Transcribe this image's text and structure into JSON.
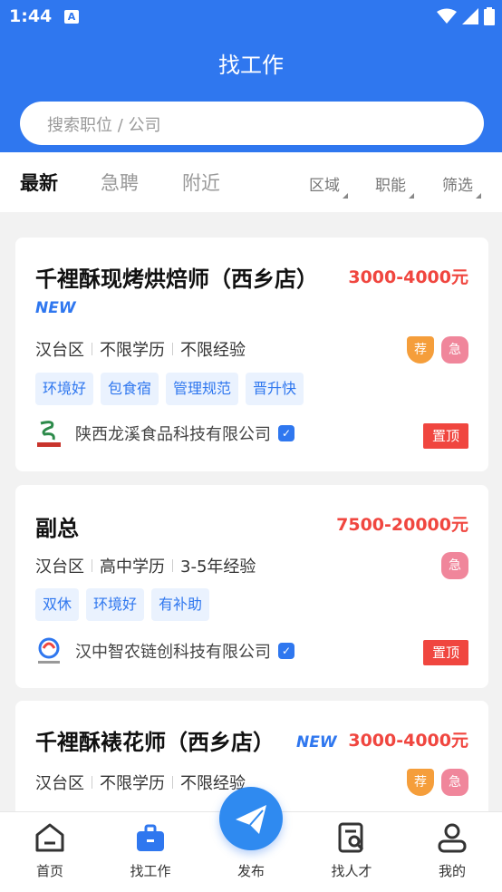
{
  "status": {
    "time": "1:44",
    "notif_icon": "A"
  },
  "header": {
    "title": "找工作"
  },
  "search": {
    "placeholder": "搜索职位 / 公司"
  },
  "tabs": [
    "最新",
    "急聘",
    "附近"
  ],
  "filters": [
    "区域",
    "职能",
    "筛选"
  ],
  "jobs": [
    {
      "title": "千裡酥现烤烘焙师（西乡店）",
      "salary": "3000-4000元",
      "new": "NEW",
      "location": "汉台区",
      "education": "不限学历",
      "experience": "不限经验",
      "tags": [
        "环境好",
        "包食宿",
        "管理规范",
        "晋升快"
      ],
      "company": "陕西龙溪食品科技有限公司",
      "badges": [
        "荐",
        "急"
      ],
      "pinned": "置顶"
    },
    {
      "title": "副总",
      "salary": "7500-20000元",
      "location": "汉台区",
      "education": "高中学历",
      "experience": "3-5年经验",
      "tags": [
        "双休",
        "环境好",
        "有补助"
      ],
      "company": "汉中智农链创科技有限公司",
      "badges": [
        "急"
      ],
      "pinned": "置顶"
    },
    {
      "title": "千裡酥裱花师（西乡店）",
      "salary": "3000-4000元",
      "new": "NEW",
      "location": "汉台区",
      "education": "不限学历",
      "experience": "不限经验",
      "badges": [
        "荐",
        "急"
      ]
    }
  ],
  "nav": [
    "首页",
    "找工作",
    "发布",
    "找人才",
    "我的"
  ],
  "colors": {
    "brand": "#2f77ef",
    "salary": "#f0463f",
    "pinned": "#f0463f"
  }
}
